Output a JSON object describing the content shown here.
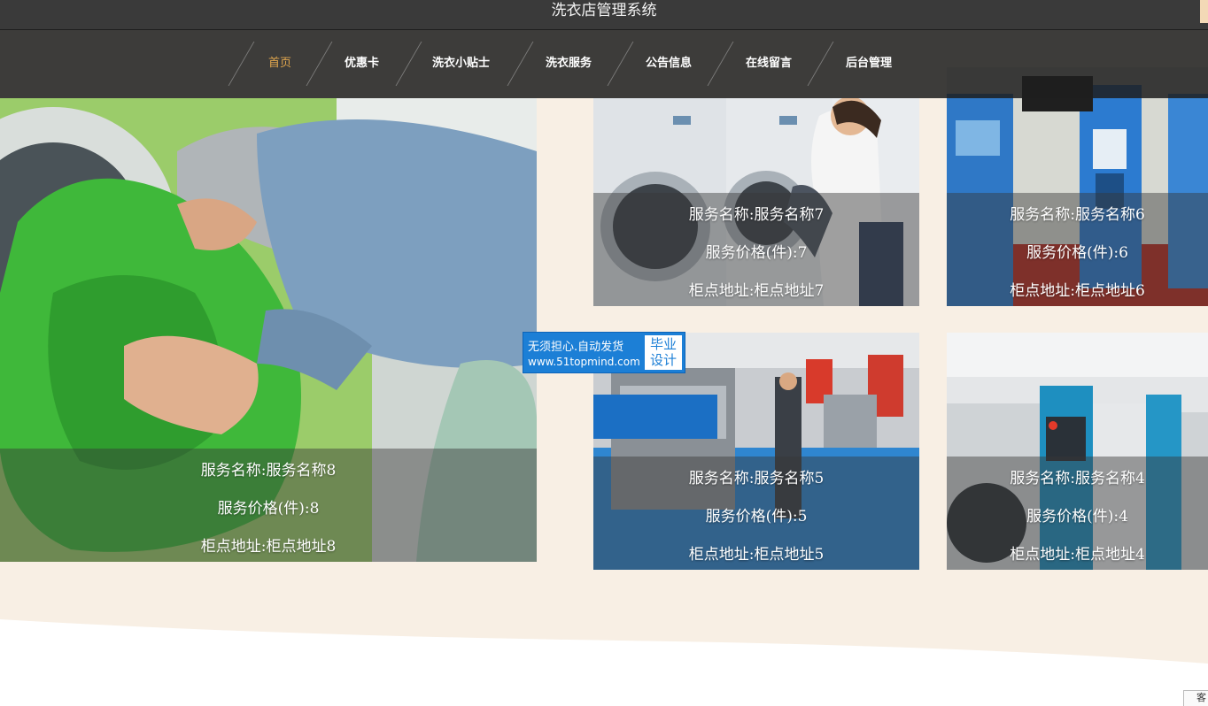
{
  "header": {
    "title": "洗衣店管理系统"
  },
  "nav": {
    "items": [
      {
        "label": "首页",
        "active": true
      },
      {
        "label": "优惠卡"
      },
      {
        "label": "洗衣小贴士"
      },
      {
        "label": "洗衣服务"
      },
      {
        "label": "公告信息"
      },
      {
        "label": "在线留言"
      },
      {
        "label": "后台管理"
      }
    ]
  },
  "services": [
    {
      "name": "服务名称:服务名称8",
      "price": "服务价格(件):8",
      "address": "柜点地址:柜点地址8"
    },
    {
      "name": "服务名称:服务名称7",
      "price": "服务价格(件):7",
      "address": "柜点地址:柜点地址7"
    },
    {
      "name": "服务名称:服务名称6",
      "price": "服务价格(件):6",
      "address": "柜点地址:柜点地址6"
    },
    {
      "name": "服务名称:服务名称5",
      "price": "服务价格(件):5",
      "address": "柜点地址:柜点地址5"
    },
    {
      "name": "服务名称:服务名称4",
      "price": "服务价格(件):4",
      "address": "柜点地址:柜点地址4"
    }
  ],
  "watermark": {
    "line1": "无须担心.自动发货",
    "line2": "www.51topmind.com",
    "tag1": "毕业",
    "tag2": "设计"
  },
  "corner_button": {
    "label": "客"
  },
  "colors": {
    "background": "#f8efe4",
    "nav_active": "#e0a64e",
    "topbar": "#3a3a3a",
    "badge": "#1c7fd6"
  }
}
